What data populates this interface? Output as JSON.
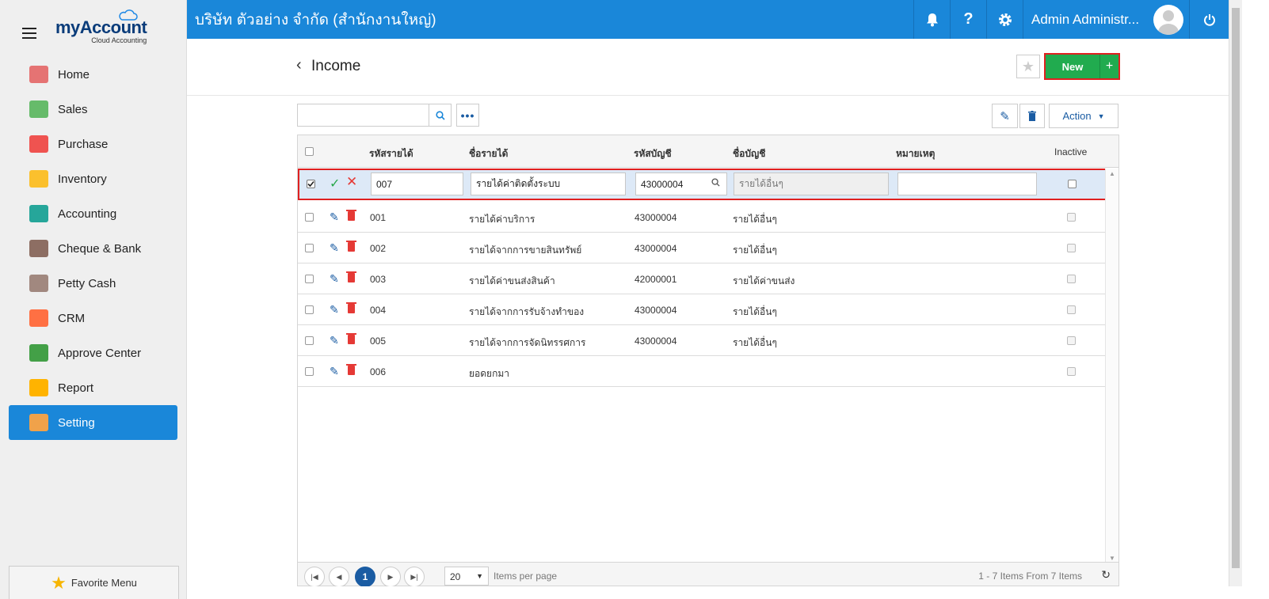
{
  "topbar": {
    "company": "บริษัท ตัวอย่าง จำกัด (สำนักงานใหญ่)",
    "user_name": "Admin Administr..."
  },
  "logo": {
    "brand": "myAccount",
    "tagline": "Cloud Accounting"
  },
  "sidebar": {
    "items": [
      {
        "label": "Home",
        "icon": "home-icon",
        "color": "#e57373"
      },
      {
        "label": "Sales",
        "icon": "money-icon",
        "color": "#66bb6a"
      },
      {
        "label": "Purchase",
        "icon": "cart-icon",
        "color": "#ef5350"
      },
      {
        "label": "Inventory",
        "icon": "box-icon",
        "color": "#fbc02d"
      },
      {
        "label": "Accounting",
        "icon": "book-icon",
        "color": "#26a69a"
      },
      {
        "label": "Cheque & Bank",
        "icon": "bank-icon",
        "color": "#8d6e63"
      },
      {
        "label": "Petty Cash",
        "icon": "wallet-icon",
        "color": "#a1887f"
      },
      {
        "label": "CRM",
        "icon": "person-icon",
        "color": "#ff7043"
      },
      {
        "label": "Approve Center",
        "icon": "check-circle-icon",
        "color": "#43a047"
      },
      {
        "label": "Report",
        "icon": "report-icon",
        "color": "#ffb300"
      },
      {
        "label": "Setting",
        "icon": "tools-icon",
        "color": "#f0a24a"
      }
    ],
    "favorite_label": "Favorite Menu"
  },
  "page": {
    "title": "Income",
    "new_label": "New",
    "action_label": "Action"
  },
  "search": {
    "value": "",
    "placeholder": ""
  },
  "grid": {
    "headers": {
      "code": "รหัสรายได้",
      "name": "ชื่อรายได้",
      "account_code": "รหัสบัญชี",
      "account_name": "ชื่อบัญชี",
      "note": "หมายเหตุ",
      "inactive": "Inactive"
    },
    "edit_row": {
      "code": "007",
      "name": "รายได้ค่าติดตั้งระบบ",
      "account_code": "43000004",
      "account_name": "รายได้อื่นๆ",
      "note": ""
    },
    "rows": [
      {
        "code": "001",
        "name": "รายได้ค่าบริการ",
        "account_code": "43000004",
        "account_name": "รายได้อื่นๆ"
      },
      {
        "code": "002",
        "name": "รายได้จากการขายสินทรัพย์",
        "account_code": "43000004",
        "account_name": "รายได้อื่นๆ"
      },
      {
        "code": "003",
        "name": "รายได้ค่าขนส่งสินค้า",
        "account_code": "42000001",
        "account_name": "รายได้ค่าขนส่ง"
      },
      {
        "code": "004",
        "name": "รายได้จากการรับจ้างทำของ",
        "account_code": "43000004",
        "account_name": "รายได้อื่นๆ"
      },
      {
        "code": "005",
        "name": "รายได้จากการจัดนิทรรศการ",
        "account_code": "43000004",
        "account_name": "รายได้อื่นๆ"
      },
      {
        "code": "006",
        "name": "ยอดยกมา",
        "account_code": "",
        "account_name": ""
      }
    ]
  },
  "pager": {
    "current_page": "1",
    "page_size": "20",
    "items_per_page_label": "Items per page",
    "info": "1 - 7 Items From 7 Items"
  }
}
